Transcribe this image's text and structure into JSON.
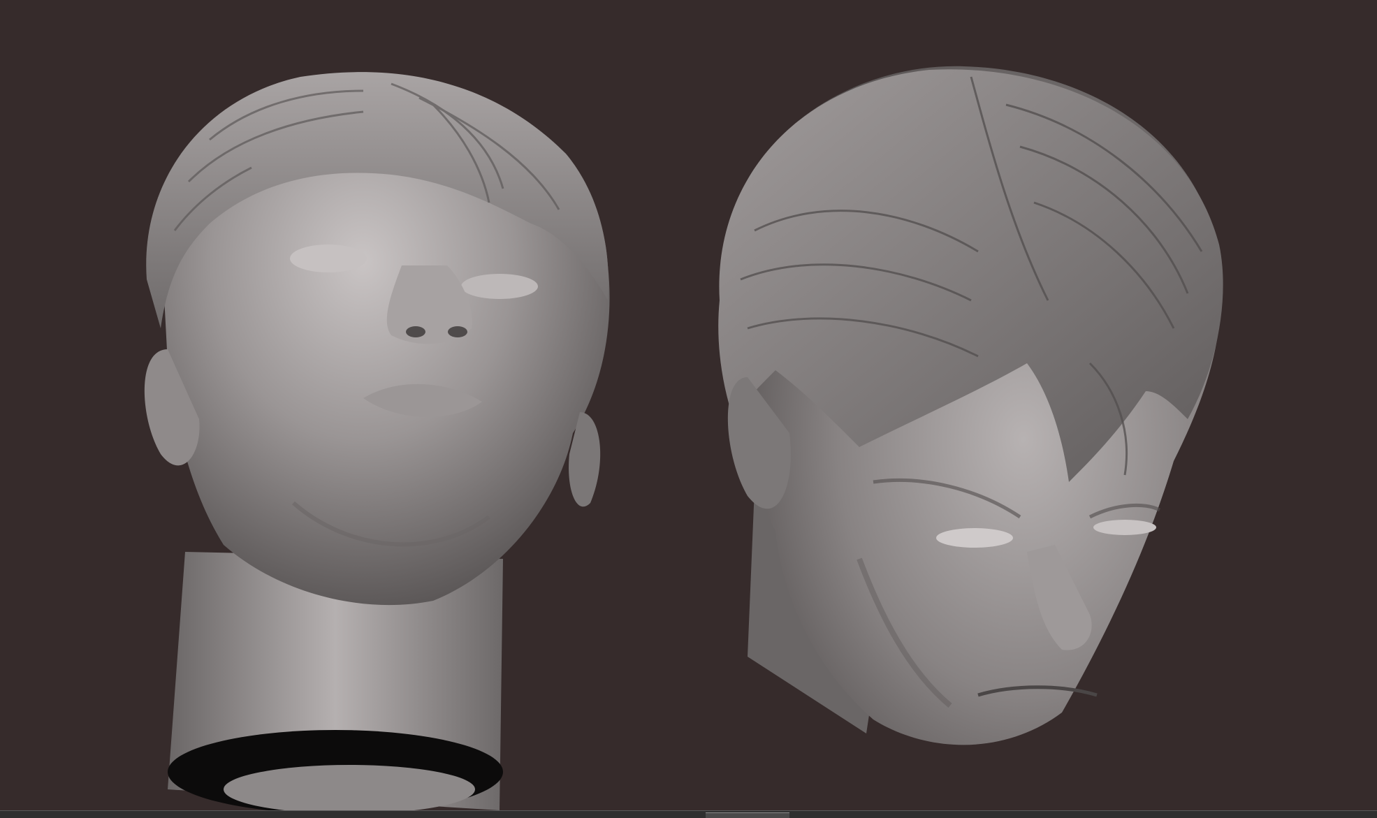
{
  "scene": {
    "background_color": "#362b2b",
    "model_color": "#8e8a8a",
    "objects": [
      {
        "name": "head-upward-view",
        "description_icon": "sculpt-head-icon"
      },
      {
        "name": "head-downward-view",
        "description_icon": "sculpt-head-icon"
      }
    ]
  },
  "ui": {
    "strip_color": "#2f2f2f"
  }
}
